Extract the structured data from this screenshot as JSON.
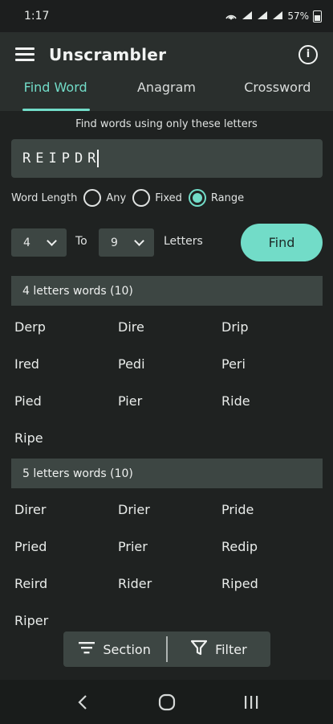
{
  "status_bar": {
    "time": "1:17",
    "battery": "57%"
  },
  "app_bar": {
    "title": "Unscrambler"
  },
  "tabs": [
    {
      "label": "Find Word",
      "active": true
    },
    {
      "label": "Anagram",
      "active": false
    },
    {
      "label": "Crossword",
      "active": false
    }
  ],
  "finder": {
    "hint": "Find words using only these letters",
    "letters": "REIPDR",
    "word_length_label": "Word Length",
    "options": [
      "Any",
      "Fixed",
      "Range"
    ],
    "selected_option": "Range",
    "min_value": "4",
    "to_label": "To",
    "max_value": "9",
    "letters_label": "Letters",
    "find_label": "Find"
  },
  "sections": [
    {
      "title": "4 letters words (10)",
      "words": [
        "Derp",
        "Dire",
        "Drip",
        "Ired",
        "Pedi",
        "Peri",
        "Pied",
        "Pier",
        "Ride",
        "Ripe"
      ]
    },
    {
      "title": "5 letters words (10)",
      "words": [
        "Direr",
        "Drier",
        "Pride",
        "Pried",
        "Prier",
        "Redip",
        "Reird",
        "Rider",
        "Riped",
        "Riper"
      ]
    }
  ],
  "bottom_bar": {
    "section_label": "Section",
    "filter_label": "Filter"
  },
  "colors": {
    "accent": "#72dcc8",
    "background": "#1f2221",
    "surface": "#3d4643"
  }
}
